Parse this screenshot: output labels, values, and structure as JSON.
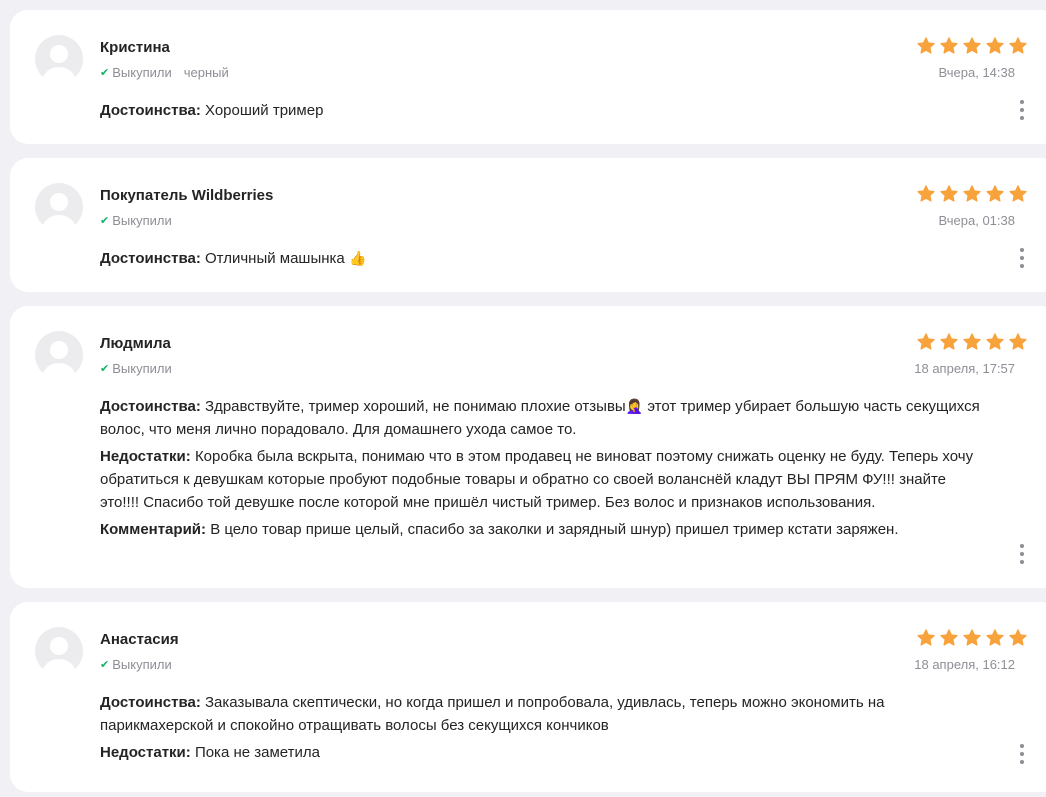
{
  "reviews": [
    {
      "author": "Кристина",
      "purchase_status": "Выкупили",
      "variant": "черный",
      "date": "Вчера, 14:38",
      "rating": 5,
      "pros_label": "Достоинства:",
      "pros": "Хороший тример"
    },
    {
      "author": "Покупатель Wildberries",
      "purchase_status": "Выкупили",
      "date": "Вчера, 01:38",
      "rating": 5,
      "pros_label": "Достоинства:",
      "pros": "Отличный машынка",
      "pros_emoji": "👍"
    },
    {
      "author": "Людмила",
      "purchase_status": "Выкупили",
      "date": "18 апреля, 17:57",
      "rating": 5,
      "pros_label": "Достоинства:",
      "pros_part1": "Здравствуйте, тример хороший, не понимаю плохие отзывы",
      "pros_emoji": "🤦‍♀️",
      "pros_part2": "этот тример убирает большую часть секущихся волос, что меня лично порадовало. Для домашнего ухода самое то.",
      "cons_label": "Недостатки:",
      "cons": "Коробка была вскрыта, понимаю что в этом продавец не виноват поэтому снижать оценку не буду. Теперь хочу обратиться к девушкам которые пробуют подобные товары и обратно со своей воланснёй кладут ВЫ ПРЯМ ФУ!!! знайте это!!!! Спасибо той девушке после которой мне пришёл чистый тример. Без волос и признаков использования.",
      "comment_label": "Комментарий:",
      "comment": "В цело товар прише целый, спасибо за заколки и зарядный шнур) пришел тример кстати заряжен."
    },
    {
      "author": "Анастасия",
      "purchase_status": "Выкупили",
      "date": "18 апреля, 16:12",
      "rating": 5,
      "pros_label": "Достоинства:",
      "pros": "Заказывала скептически, но когда пришел и попробовала, удивлась, теперь можно экономить на парикмахерской и спокойно отращивать волосы без секущихся кончиков",
      "cons_label": "Недостатки:",
      "cons": "Пока не заметила"
    }
  ],
  "colors": {
    "star": "#f8a23c",
    "verified": "#18b06a",
    "muted": "#8e8e96",
    "page_bg": "#f1f1f5"
  },
  "icons": {
    "check": "✔",
    "star": "star-icon",
    "menu": "more-vertical-icon",
    "avatar": "user-avatar-placeholder"
  }
}
